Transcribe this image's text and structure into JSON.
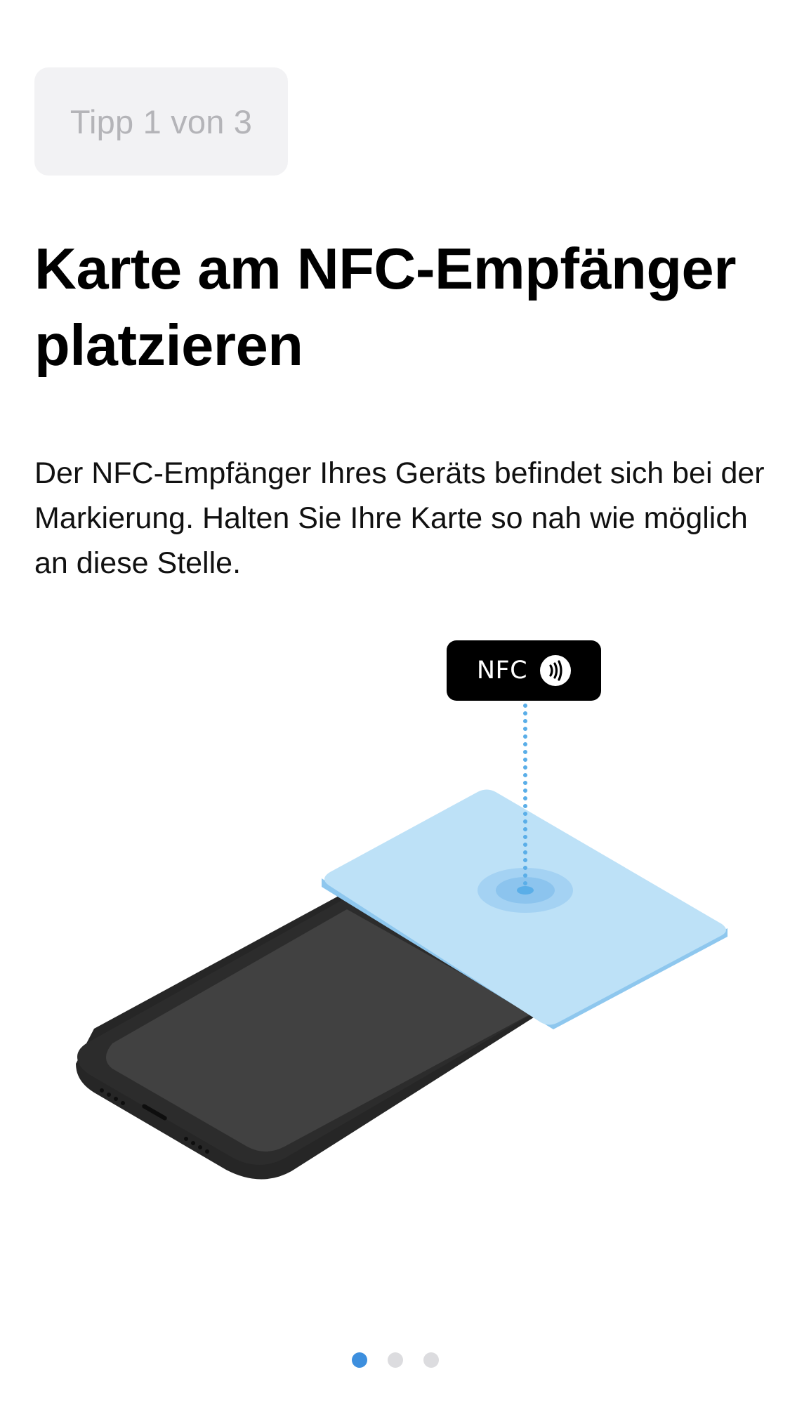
{
  "header": {
    "tip_label": "Tipp 1 von 3"
  },
  "main": {
    "title": "Karte am NFC-Empfänger platzieren",
    "description": "Der NFC-Empfänger Ihres Geräts befindet sich bei der Markierung. Halten Sie Ihre Karte so nah wie möglich an diese Stelle."
  },
  "illustration": {
    "nfc_label": "NFC",
    "nfc_icon": "contactless-icon",
    "card_color": "#bde1f7",
    "marker_color": "#5aaee8",
    "phone_color": "#262626",
    "screen_color": "#414141"
  },
  "pagination": {
    "total": 3,
    "current": 1,
    "active_color": "#3d8fde",
    "inactive_color": "#dcdcdf"
  }
}
